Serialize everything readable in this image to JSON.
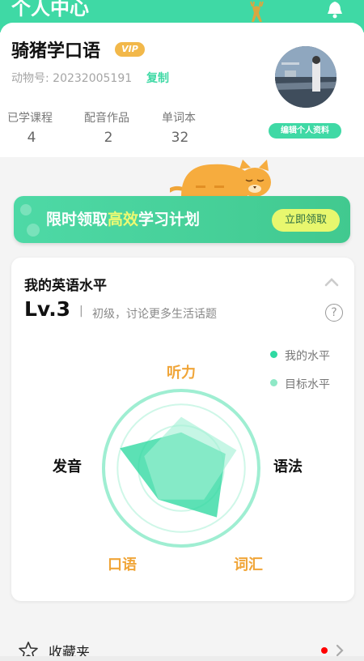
{
  "header": {
    "title": "个人中心",
    "deer_icon": "deer-icon",
    "bell_icon": "bell-icon"
  },
  "profile": {
    "name": "骑猪学口语",
    "vip_badge": "VIP",
    "id_label": "动物号: 20232005191",
    "copy_label": "复制",
    "edit_label": "编辑个人资料",
    "stats": [
      {
        "label": "已学课程",
        "value": "4"
      },
      {
        "label": "配音作品",
        "value": "2"
      },
      {
        "label": "单词本",
        "value": "32"
      }
    ]
  },
  "banner": {
    "text_before": "限时领取",
    "text_highlight": "高效",
    "text_after": "学习计划",
    "button_label": "立即领取"
  },
  "level": {
    "title": "我的英语水平",
    "level": "Lv.3",
    "separator": "|",
    "description": "初级，讨论更多生活话题",
    "help": "?",
    "legend": [
      {
        "label": "我的水平",
        "color": "#2fd9a2"
      },
      {
        "label": "目标水平",
        "color": "#8ee8c6"
      }
    ],
    "axes": {
      "listening": "听力",
      "grammar": "语法",
      "vocabulary": "词汇",
      "speaking": "口语",
      "pronunciation": "发音"
    },
    "colors": {
      "accent_orange": "#f0a538",
      "mine": "#2fd9a2",
      "target": "#8ee8c6"
    }
  },
  "favorites": {
    "label": "收藏夹"
  },
  "chart_data": {
    "type": "radar",
    "categories": [
      "听力",
      "语法",
      "词汇",
      "口语",
      "发音"
    ],
    "series": [
      {
        "name": "我的水平",
        "values": [
          0.46,
          0.6,
          0.78,
          0.5,
          0.83
        ]
      },
      {
        "name": "目标水平",
        "values": [
          0.66,
          0.75,
          0.5,
          0.5,
          0.5
        ]
      }
    ],
    "ylim": [
      0,
      1
    ]
  }
}
